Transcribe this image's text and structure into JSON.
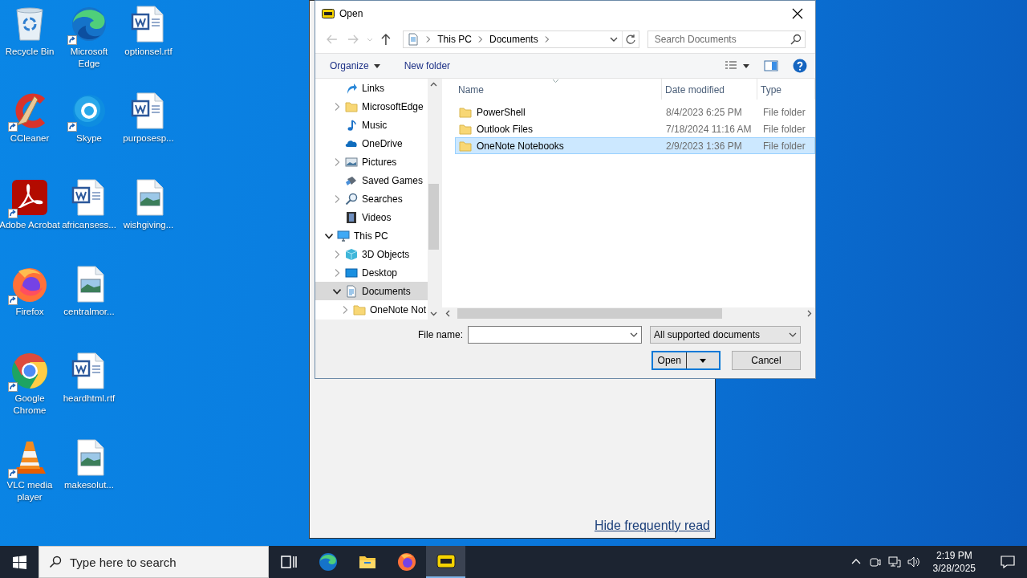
{
  "desktop_icons": [
    {
      "label": "Recycle Bin",
      "kind": "recycle",
      "shortcut": false
    },
    {
      "label": "CCleaner",
      "kind": "ccleaner",
      "shortcut": true
    },
    {
      "label": "Adobe Acrobat",
      "kind": "acrobat",
      "shortcut": true
    },
    {
      "label": "Firefox",
      "kind": "firefox",
      "shortcut": true
    },
    {
      "label": "Google Chrome",
      "kind": "chrome",
      "shortcut": true
    },
    {
      "label": "VLC media player",
      "kind": "vlc",
      "shortcut": true
    },
    {
      "label": "Microsoft Edge",
      "kind": "edge",
      "shortcut": true
    },
    {
      "label": "Skype",
      "kind": "skype",
      "shortcut": true
    },
    {
      "label": "africansess...",
      "kind": "word",
      "shortcut": false
    },
    {
      "label": "centralmor...",
      "kind": "image",
      "shortcut": false
    },
    {
      "label": "heardhtml.rtf",
      "kind": "word",
      "shortcut": false
    },
    {
      "label": "makesolut...",
      "kind": "image",
      "shortcut": false
    },
    {
      "label": "optionsel.rtf",
      "kind": "word",
      "shortcut": false
    },
    {
      "label": "purposesp...",
      "kind": "word",
      "shortcut": false
    },
    {
      "label": "wishgiving...",
      "kind": "image",
      "shortcut": false
    }
  ],
  "background_window": {
    "link": "Hide frequently read"
  },
  "dialog": {
    "title": "Open",
    "breadcrumb": [
      "This PC",
      "Documents"
    ],
    "search_placeholder": "Search Documents",
    "toolbar": {
      "organize": "Organize",
      "new_folder": "New folder"
    },
    "tree": {
      "upper_items": [
        {
          "label": "Links",
          "kind": "links",
          "selected": false
        },
        {
          "label": "MicrosoftEdge",
          "kind": "folder",
          "expanded": false,
          "selected": false
        },
        {
          "label": "Music",
          "kind": "music",
          "selected": false
        },
        {
          "label": "OneDrive",
          "kind": "cloud",
          "selected": false
        },
        {
          "label": "Pictures",
          "kind": "pictures",
          "expanded": false,
          "selected": false
        },
        {
          "label": "Saved Games",
          "kind": "games",
          "selected": false
        },
        {
          "label": "Searches",
          "kind": "search",
          "expanded": false,
          "selected": false
        },
        {
          "label": "Videos",
          "kind": "videos",
          "selected": false
        }
      ],
      "items": [
        {
          "label": "This PC",
          "kind": "pc",
          "expanded": true,
          "selected": false,
          "children": [
            {
              "label": "3D Objects",
              "kind": "cube",
              "expanded": false,
              "selected": false
            },
            {
              "label": "Desktop",
              "kind": "desktop",
              "expanded": false,
              "selected": false
            },
            {
              "label": "Documents",
              "kind": "documents",
              "expanded": true,
              "selected": true,
              "children": [
                {
                  "label": "OneNote Not",
                  "kind": "folder",
                  "expanded": false,
                  "selected": false
                }
              ]
            }
          ]
        }
      ]
    },
    "columns": [
      "Name",
      "Date modified",
      "Type"
    ],
    "files": [
      {
        "name": "PowerShell",
        "date": "8/4/2023 6:25 PM",
        "type": "File folder",
        "selected": false
      },
      {
        "name": "Outlook Files",
        "date": "7/18/2024 11:16 AM",
        "type": "File folder",
        "selected": false
      },
      {
        "name": "OneNote Notebooks",
        "date": "2/9/2023 1:36 PM",
        "type": "File folder",
        "selected": true
      }
    ],
    "file_name_label": "File name:",
    "filter": "All supported documents",
    "open_button": "Open",
    "cancel_button": "Cancel"
  },
  "taskbar": {
    "search_placeholder": "Type here to search",
    "apps": [
      {
        "kind": "taskview",
        "active": false
      },
      {
        "kind": "edge",
        "active": false
      },
      {
        "kind": "explorer",
        "active": false
      },
      {
        "kind": "firefox",
        "active": false
      },
      {
        "kind": "pdf",
        "active": true
      }
    ],
    "time": "2:19 PM",
    "date": "3/28/2025"
  }
}
